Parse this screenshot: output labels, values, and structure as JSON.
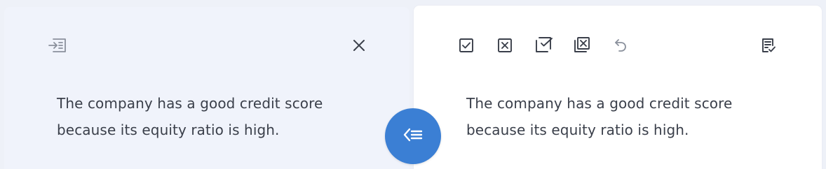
{
  "left_panel": {
    "text": "The company has a good credit score because its equity ratio is high.",
    "icons": {
      "insert": "insert-text-icon",
      "close": "close-icon"
    }
  },
  "right_panel": {
    "text": "The company has a good credit score because its equity ratio is high.",
    "toolbar": [
      "accept-icon",
      "reject-icon",
      "accept-all-icon",
      "reject-all-icon",
      "undo-icon",
      "review-icon"
    ]
  },
  "swap_button": {
    "icon": "apply-to-left-icon"
  },
  "colors": {
    "accent": "#3b7fd4",
    "left_bg": "#f0f3fb",
    "right_bg": "#ffffff",
    "text": "#3a3f4a",
    "icon": "#3a3f4a",
    "icon_muted": "#8a909c"
  }
}
